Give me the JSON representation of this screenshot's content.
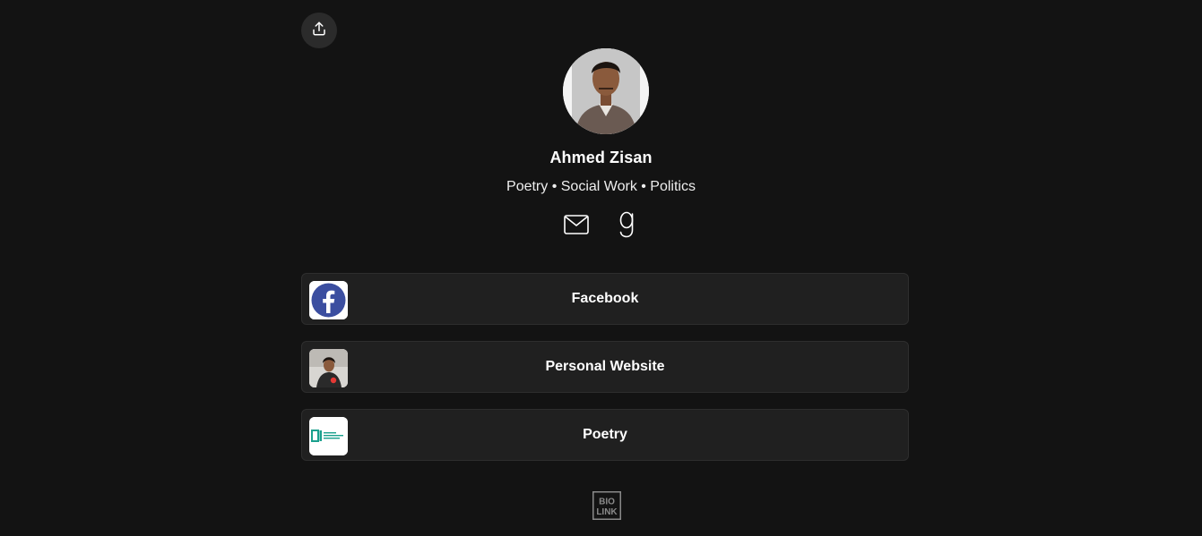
{
  "profile": {
    "name": "Ahmed Zisan",
    "bio": "Poetry • Social Work • Politics"
  },
  "header": {
    "share_icon": "share-icon"
  },
  "socials": [
    {
      "icon": "mail-icon"
    },
    {
      "icon": "goodreads-icon"
    }
  ],
  "links": [
    {
      "label": "Facebook",
      "icon": "facebook-icon"
    },
    {
      "label": "Personal Website",
      "icon": "personal-photo"
    },
    {
      "label": "Poetry",
      "icon": "poetry-site-logo"
    }
  ],
  "footer": {
    "logo_line1": "BIO",
    "logo_line2": "LINK"
  },
  "colors": {
    "background": "#131313",
    "card": "#202020",
    "card_border": "#2e2e2e",
    "facebook": "#3b4ea0",
    "poetry_teal": "#1aa08d"
  }
}
